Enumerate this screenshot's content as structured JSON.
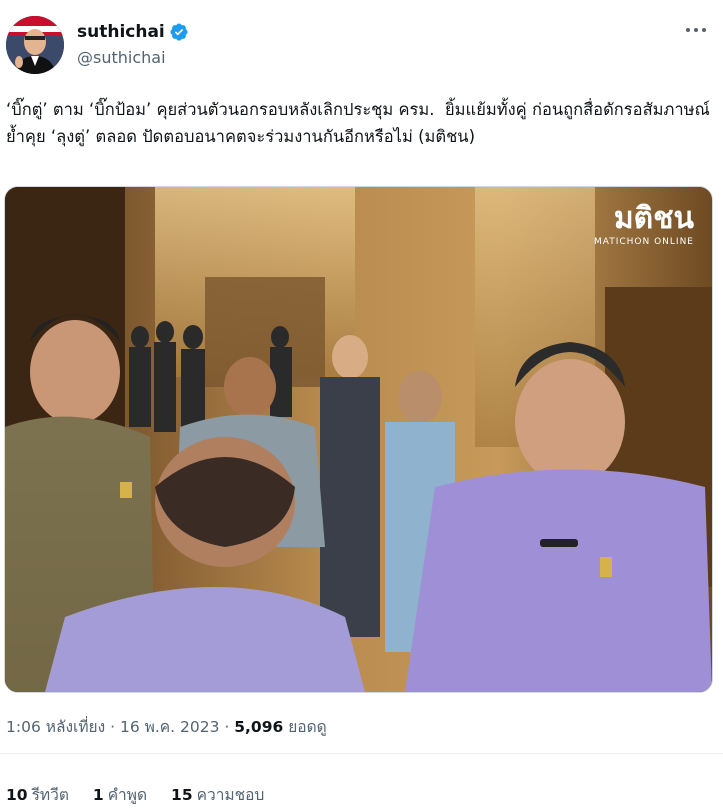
{
  "author": {
    "name": "suthichai",
    "handle": "@suthichai"
  },
  "tweet": {
    "text": "‘บิ๊กตู่’ ตาม ‘บิ๊กป้อม’ คุยส่วนตัวนอกรอบหลังเลิกประชุม ครม.  ยิ้มแย้มทั้งคู่ ก่อนถูกสื่อดักรอสัมภาษณ์ ย้ำคุย ‘ลุงตู่’ ตลอด ปัดตอบอนาคตจะร่วมงานกันอีกหรือไม่ (มติชน)"
  },
  "media": {
    "watermark_main": "มติชน",
    "watermark_sub": "MATICHON ONLINE"
  },
  "meta": {
    "time": "1:06 หลังเที่ยง",
    "date": "16 พ.ค. 2023",
    "views_count": "5,096",
    "views_label": "ยอดดู"
  },
  "stats": {
    "retweets_count": "10",
    "retweets_label": "รีทวีต",
    "quotes_count": "1",
    "quotes_label": "คำพูด",
    "likes_count": "15",
    "likes_label": "ความชอบ"
  },
  "colors": {
    "verified": "#1d9bf0",
    "secondary_text": "#536471",
    "primary_text": "#0f1419"
  },
  "icons": [
    "verified-badge-icon",
    "more-options-icon"
  ]
}
